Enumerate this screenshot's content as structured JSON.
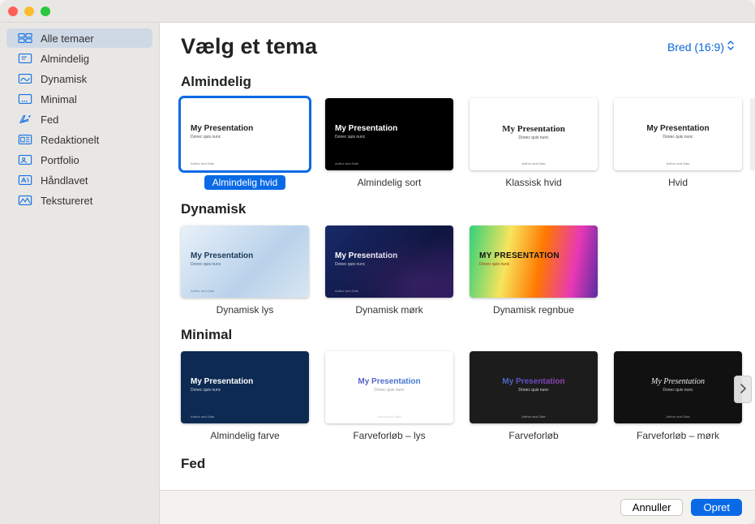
{
  "header": {
    "title": "Vælg et tema",
    "aspect_label": "Bred (16:9)"
  },
  "sidebar": {
    "items": [
      {
        "label": "Alle temaer",
        "icon": "all"
      },
      {
        "label": "Almindelig",
        "icon": "basic"
      },
      {
        "label": "Dynamisk",
        "icon": "dynamic"
      },
      {
        "label": "Minimal",
        "icon": "minimal"
      },
      {
        "label": "Fed",
        "icon": "bold"
      },
      {
        "label": "Redaktionelt",
        "icon": "editorial"
      },
      {
        "label": "Portfolio",
        "icon": "portfolio"
      },
      {
        "label": "Håndlavet",
        "icon": "craft"
      },
      {
        "label": "Tekstureret",
        "icon": "textured"
      }
    ]
  },
  "slide_sample": {
    "title": "My Presentation",
    "subtitle": "Donec quis nunc",
    "author": "Author and Date",
    "title_upper": "MY PRESENTATION"
  },
  "sections": [
    {
      "title": "Almindelig",
      "themes": [
        {
          "label": "Almindelig hvid"
        },
        {
          "label": "Almindelig sort"
        },
        {
          "label": "Klassisk hvid"
        },
        {
          "label": "Hvid"
        }
      ]
    },
    {
      "title": "Dynamisk",
      "themes": [
        {
          "label": "Dynamisk lys"
        },
        {
          "label": "Dynamisk mørk"
        },
        {
          "label": "Dynamisk regnbue"
        }
      ]
    },
    {
      "title": "Minimal",
      "themes": [
        {
          "label": "Almindelig farve"
        },
        {
          "label": "Farveforløb – lys"
        },
        {
          "label": "Farveforløb"
        },
        {
          "label": "Farveforløb – mørk"
        }
      ]
    },
    {
      "title": "Fed",
      "themes": []
    }
  ],
  "footer": {
    "cancel": "Annuller",
    "create": "Opret"
  }
}
